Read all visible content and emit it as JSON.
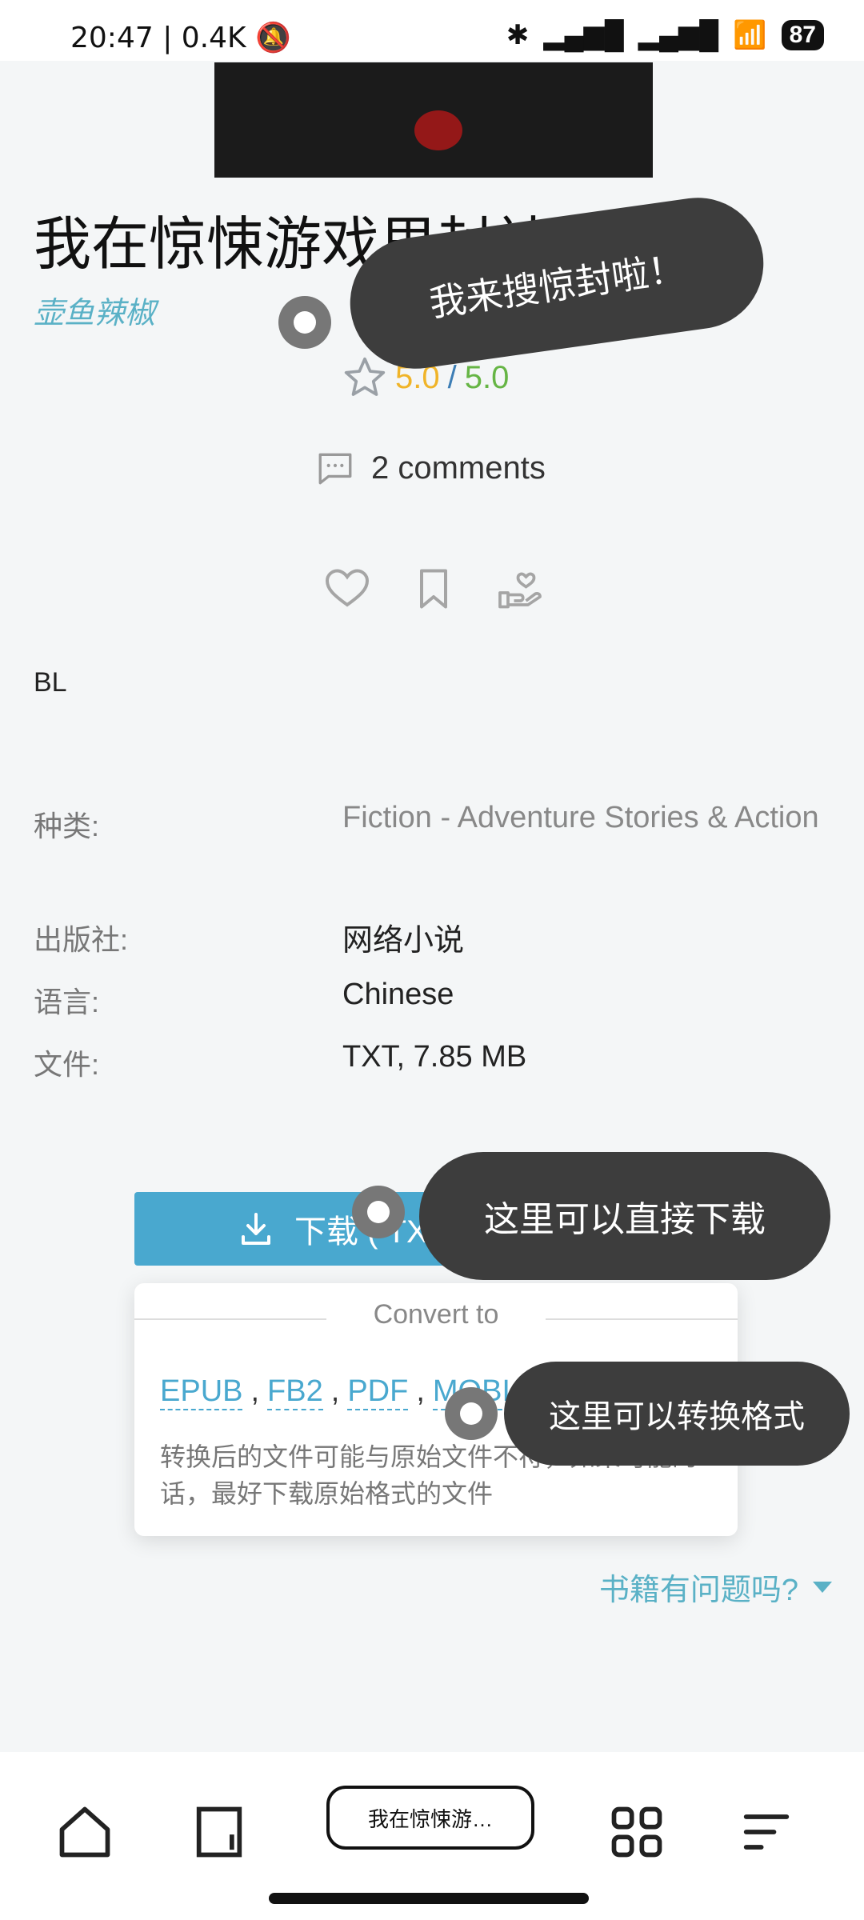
{
  "status_bar": {
    "time": "20:47",
    "speed": "0.4K",
    "battery": "87"
  },
  "book": {
    "title": "我在惊悚游戏里封神",
    "author": "壶鱼辣椒",
    "rating_a": "5.0",
    "rating_sep": "/",
    "rating_b": "5.0",
    "comments": "2 comments",
    "tag": "BL"
  },
  "meta": {
    "category_label": "种类:",
    "category_value": "Fiction - Adventure Stories & Action",
    "publisher_label": "出版社:",
    "publisher_value": "网络小说",
    "language_label": "语言:",
    "language_value": "Chinese",
    "file_label": "文件:",
    "file_value": "TXT, 7.85 MB"
  },
  "download": {
    "label": "下载 ( TXT"
  },
  "convert": {
    "title": "Convert to",
    "formats": [
      "EPUB",
      "FB2",
      "PDF",
      "MOBI"
    ],
    "note": "转换后的文件可能与原始文件不符，如果可能的话，最好下载原始格式的文件"
  },
  "problem_link": "书籍有问题吗?",
  "overlays": {
    "bubble1": "我来搜惊封啦！",
    "bubble2": "这里可以直接下载",
    "bubble3": "这里可以转换格式"
  },
  "bottom_nav": {
    "tab_label": "我在惊悚游…"
  },
  "colors": {
    "accent": "#49a8cf",
    "author": "#5ab1c6",
    "star": "#f0b429",
    "rating_green": "#66b545",
    "bubble_bg": "#3d3d3d"
  }
}
